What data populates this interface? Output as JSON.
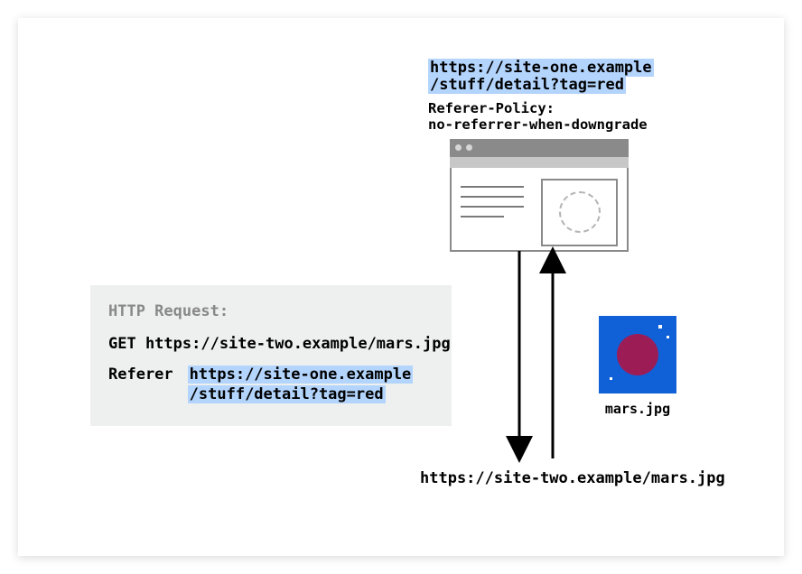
{
  "diagram": {
    "top_url_line1": "https://site-one.example",
    "top_url_line2": "/stuff/detail?tag=red",
    "referer_policy_label": "Referer-Policy:",
    "referer_policy_value": "no-referrer-when-downgrade",
    "http_box": {
      "title": "HTTP Request:",
      "method_line": "GET https://site-two.example/mars.jpg",
      "referer_label": "Referer",
      "referer_value_line1": "https://site-one.example",
      "referer_value_line2": "/stuff/detail?tag=red"
    },
    "image_filename": "mars.jpg",
    "bottom_url": "https://site-two.example/mars.jpg"
  },
  "colors": {
    "highlight": "#b3d4fc",
    "image_bg": "#1060d8",
    "planet": "#9c1d56"
  }
}
